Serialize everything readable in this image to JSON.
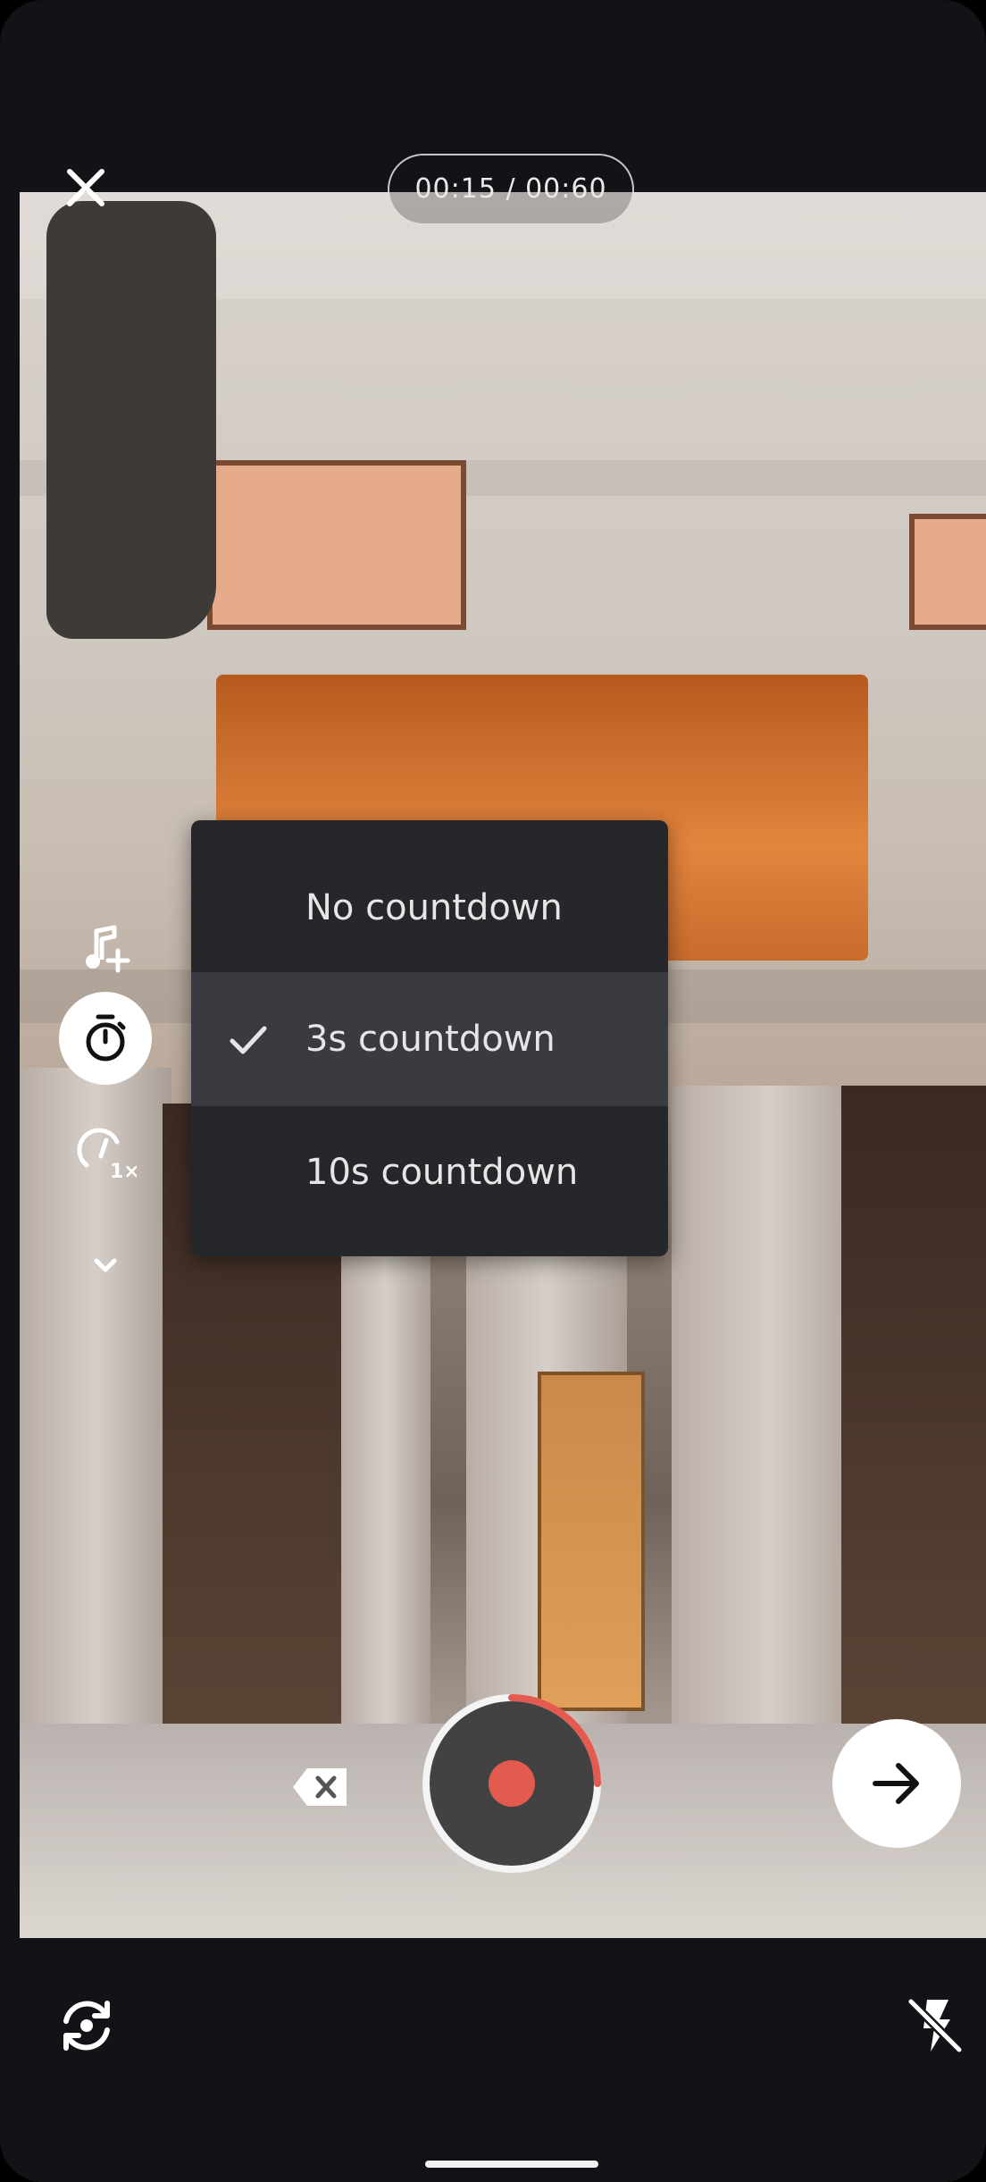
{
  "header": {
    "close_icon": "close-icon",
    "recording_timer": "00:15 / 00:60"
  },
  "toolbar": {
    "items": [
      {
        "icon": "music-add-icon",
        "active": false
      },
      {
        "icon": "timer-icon",
        "active": true
      },
      {
        "icon": "speed-1x-icon",
        "active": false
      },
      {
        "icon": "chevron-down-icon",
        "active": false
      }
    ]
  },
  "countdown_menu": {
    "items": [
      {
        "label": "No countdown",
        "selected": false
      },
      {
        "label": "3s countdown",
        "selected": true
      },
      {
        "label": "10s countdown",
        "selected": false
      }
    ]
  },
  "controls": {
    "delete_icon": "backspace-icon",
    "record_progress": 0.25,
    "record_color": "#e35b4e",
    "next_icon": "arrow-right-icon"
  },
  "bottom_bar": {
    "flip_icon": "camera-flip-icon",
    "flash_icon": "flash-off-icon"
  }
}
